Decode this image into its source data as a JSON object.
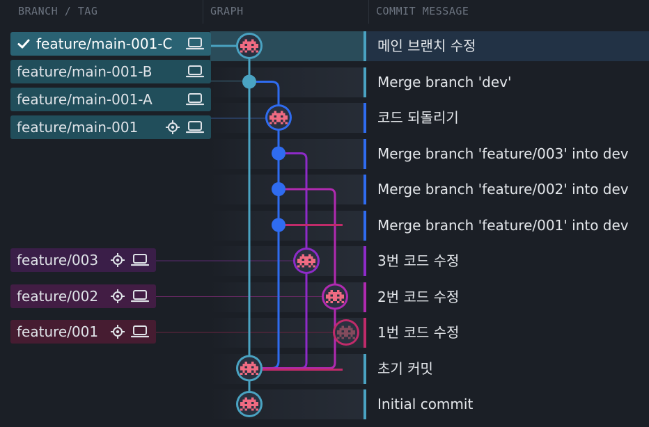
{
  "headers": {
    "branch_tag": "BRANCH / TAG",
    "graph": "GRAPH",
    "commit_message": "COMMIT MESSAGE"
  },
  "colors": {
    "lane_main": "#4aa3c2",
    "lane_dev": "#2f6cf0",
    "lane_003": "#8e2bc9",
    "lane_002": "#b02ab0",
    "lane_001": "#c02b6a",
    "avatar": "#ef6b82"
  },
  "branch_groups": [
    {
      "color": "#214e5b",
      "items": [
        {
          "label": "feature/main-001-C",
          "checked": true,
          "icons": [
            "laptop-icon"
          ]
        },
        {
          "label": "feature/main-001-B",
          "checked": false,
          "icons": [
            "laptop-icon"
          ]
        },
        {
          "label": "feature/main-001-A",
          "checked": false,
          "icons": [
            "laptop-icon"
          ]
        },
        {
          "label": "feature/main-001",
          "checked": false,
          "icons": [
            "target-icon",
            "laptop-icon"
          ]
        }
      ]
    },
    {
      "color": "#3a1e48",
      "items": [
        {
          "label": "feature/003",
          "checked": false,
          "icons": [
            "target-icon",
            "laptop-icon"
          ]
        }
      ]
    },
    {
      "color": "#421d44",
      "items": [
        {
          "label": "feature/002",
          "checked": false,
          "icons": [
            "target-icon",
            "laptop-icon"
          ]
        }
      ]
    },
    {
      "color": "#461c31",
      "items": [
        {
          "label": "feature/001",
          "checked": false,
          "icons": [
            "target-icon",
            "laptop-icon"
          ]
        }
      ]
    }
  ],
  "commits": [
    {
      "message": "메인 브랜치 수정",
      "bar_color": "#4aa3c2",
      "selected": true
    },
    {
      "message": "Merge branch 'dev'",
      "bar_color": "#4aa3c2",
      "selected": false
    },
    {
      "message": "코드 되돌리기",
      "bar_color": "#2f6cf0",
      "selected": false
    },
    {
      "message": "Merge branch 'feature/003' into dev",
      "bar_color": "#2f6cf0",
      "selected": false
    },
    {
      "message": "Merge branch 'feature/002' into dev",
      "bar_color": "#2f6cf0",
      "selected": false
    },
    {
      "message": "Merge branch 'feature/001' into dev",
      "bar_color": "#2f6cf0",
      "selected": false
    },
    {
      "message": "3번 코드 수정",
      "bar_color": "#8e2bc9",
      "selected": false
    },
    {
      "message": "2번 코드 수정",
      "bar_color": "#b02ab0",
      "selected": false
    },
    {
      "message": "1번 코드 수정",
      "bar_color": "#c02b6a",
      "selected": false
    },
    {
      "message": "초기 커밋",
      "bar_color": "#4aa3c2",
      "selected": false
    },
    {
      "message": "Initial commit",
      "bar_color": "#4aa3c2",
      "selected": false
    }
  ]
}
